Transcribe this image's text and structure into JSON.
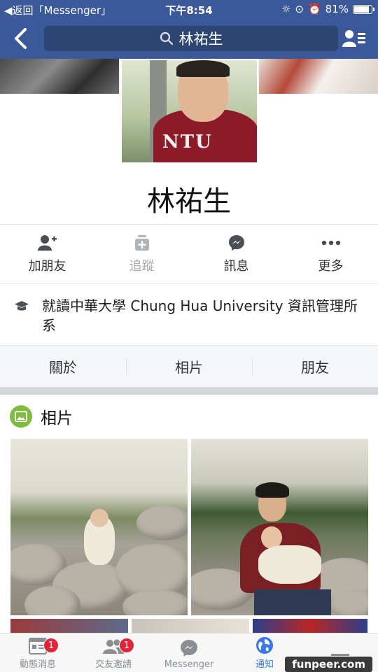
{
  "status": {
    "back_app": "◀返回「Messenger」",
    "time": "下午8:54",
    "battery": "81%",
    "battery_level": 0.81
  },
  "nav": {
    "search_text": "林祐生"
  },
  "profile": {
    "name": "林祐生",
    "hoodie_text": "NTU"
  },
  "actions": [
    {
      "label": "加朋友",
      "icon": "add-friend-icon"
    },
    {
      "label": "追蹤",
      "icon": "follow-icon"
    },
    {
      "label": "訊息",
      "icon": "messenger-icon"
    },
    {
      "label": "更多",
      "icon": "more-icon"
    }
  ],
  "info": {
    "education": "就讀中華大學 Chung Hua University 資訊管理所系",
    "icon": "graduation-cap-icon"
  },
  "tabs": [
    "關於",
    "相片",
    "朋友"
  ],
  "photos": {
    "title": "相片",
    "icon": "photo-album-icon"
  },
  "tabbar": [
    {
      "label": "動態消息",
      "badge": "1",
      "icon": "news-feed-icon"
    },
    {
      "label": "交友邀請",
      "badge": "1",
      "icon": "friend-requests-icon"
    },
    {
      "label": "Messenger",
      "badge": "",
      "icon": "messenger-icon"
    },
    {
      "label": "通知",
      "badge": "",
      "icon": "globe-icon"
    },
    {
      "label": "",
      "badge": "",
      "icon": "menu-icon"
    }
  ],
  "watermark": "funpeer.com",
  "colors": {
    "brand": "#3b5998",
    "badge": "#e0243a",
    "active_tab": "#3b78e7"
  }
}
